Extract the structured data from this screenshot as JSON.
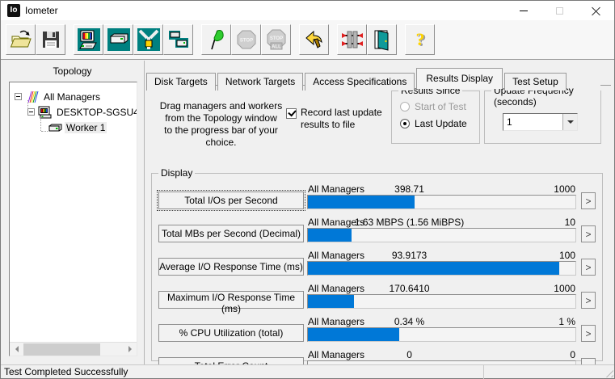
{
  "window": {
    "title": "Iometer",
    "icon_text": "Io"
  },
  "toolbar": {
    "stop_text": "STOP",
    "all_text": "ALL",
    "help_glyph": "?"
  },
  "topology": {
    "title": "Topology",
    "items": [
      {
        "label": "All Managers"
      },
      {
        "label": "DESKTOP-SGSU4"
      },
      {
        "label": "Worker 1"
      }
    ]
  },
  "tabs": {
    "items": [
      {
        "label": "Disk Targets"
      },
      {
        "label": "Network Targets"
      },
      {
        "label": "Access Specifications"
      },
      {
        "label": "Results Display"
      },
      {
        "label": "Test Setup"
      }
    ],
    "active": "Results Display"
  },
  "results_panel": {
    "drag_text": "Drag managers and workers\nfrom the Topology window\nto the progress bar of your choice.",
    "record_checkbox_label": "Record last update\nresults to file",
    "record_checkbox_checked": true,
    "results_since": {
      "title": "Results Since",
      "options": [
        {
          "label": "Start of Test",
          "selected": false,
          "disabled": true
        },
        {
          "label": "Last Update",
          "selected": true,
          "disabled": false
        }
      ]
    },
    "update_frequency": {
      "title": "Update Frequency (seconds)",
      "value": "1"
    },
    "display": {
      "title": "Display",
      "expand_glyph": ">",
      "rows": [
        {
          "button": "Total I/Os per Second",
          "scope": "All Managers",
          "value": "398.71",
          "max": "1000",
          "percent_full": 39.9
        },
        {
          "button": "Total MBs per Second (Decimal)",
          "scope": "All Managers",
          "value": "1.63 MBPS (1.56 MiBPS)",
          "max": "10",
          "percent_full": 16.3
        },
        {
          "button": "Average I/O Response Time (ms)",
          "scope": "All Managers",
          "value": "93.9173",
          "max": "100",
          "percent_full": 93.9
        },
        {
          "button": "Maximum I/O Response Time (ms)",
          "scope": "All Managers",
          "value": "170.6410",
          "max": "1000",
          "percent_full": 17.1
        },
        {
          "button": "% CPU Utilization (total)",
          "scope": "All Managers",
          "value": "0.34 %",
          "max": "1 %",
          "percent_full": 34.0
        },
        {
          "button": "Total Error Count",
          "scope": "All Managers",
          "value": "0",
          "max": "0",
          "percent_full": 0
        }
      ]
    }
  },
  "status_bar": {
    "text": "Test Completed Successfully"
  },
  "colors": {
    "accent_blue": "#0078d7",
    "icon_teal": "#008080"
  }
}
